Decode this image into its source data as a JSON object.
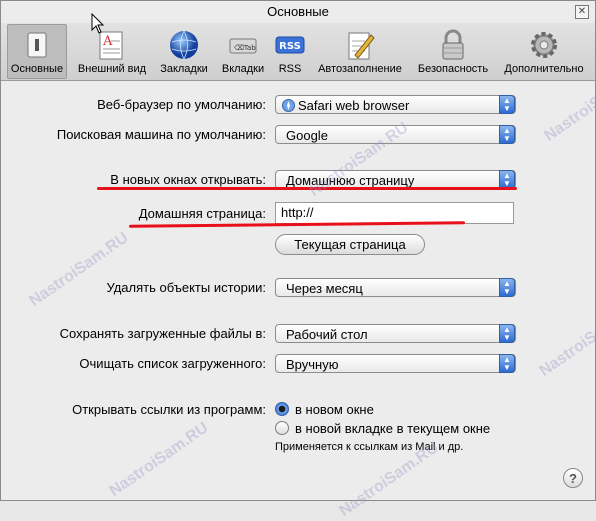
{
  "window": {
    "title": "Основные",
    "close_glyph": "✕"
  },
  "toolbar": {
    "items": [
      {
        "label": "Основные",
        "icon": "switch-icon"
      },
      {
        "label": "Внешний вид",
        "icon": "appearance-icon"
      },
      {
        "label": "Закладки",
        "icon": "globe-icon"
      },
      {
        "label": "Вкладки",
        "icon": "tabs-icon"
      },
      {
        "label": "RSS",
        "icon": "rss-icon"
      },
      {
        "label": "Автозаполнение",
        "icon": "pencil-icon"
      },
      {
        "label": "Безопасность",
        "icon": "lock-icon"
      },
      {
        "label": "Дополнительно",
        "icon": "gear-icon"
      }
    ],
    "rss_badge": "RSS",
    "tab_badge": "⌫Tab"
  },
  "settings": {
    "default_browser_label": "Веб-браузер по умолчанию:",
    "default_browser_value": "Safari web browser",
    "search_engine_label": "Поисковая машина по умолчанию:",
    "search_engine_value": "Google",
    "new_windows_label": "В новых окнах открывать:",
    "new_windows_value": "Домашнюю страницу",
    "homepage_label": "Домашняя страница:",
    "homepage_value": "http://",
    "current_page_button": "Текущая страница",
    "history_label": "Удалять объекты истории:",
    "history_value": "Через месяц",
    "downloads_label": "Сохранять загруженные файлы в:",
    "downloads_value": "Рабочий стол",
    "clear_downloads_label": "Очищать список загруженного:",
    "clear_downloads_value": "Вручную",
    "open_links_label": "Открывать ссылки из программ:",
    "open_links_options": [
      "в новом окне",
      "в новой вкладке в текущем окне"
    ],
    "open_links_note": "Применяется к ссылкам из Mail и др."
  },
  "help_glyph": "?",
  "watermark": "NastroiSam.RU",
  "colors": {
    "highlight_red": "#e8101a",
    "popup_blue": "#2d6ad2"
  }
}
